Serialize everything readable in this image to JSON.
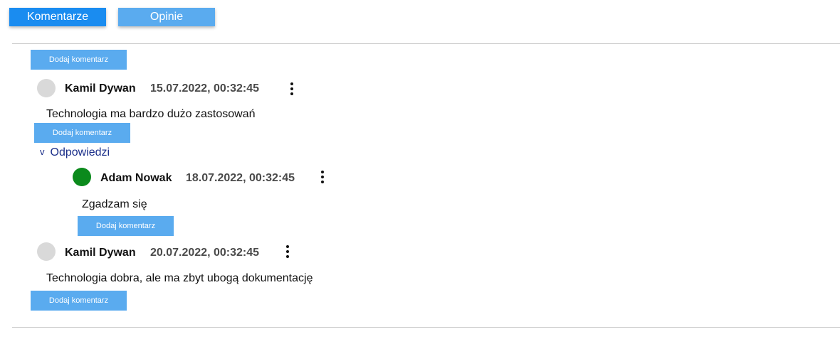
{
  "tabs": {
    "comments": "Komentarze",
    "reviews": "Opinie"
  },
  "add_comment_label": "Dodaj komentarz",
  "comments": [
    {
      "author": "Kamil Dywan",
      "timestamp": "15.07.2022, 00:32:45",
      "text": "Technologia ma bardzo dużo zastosowań",
      "replies_toggle": "Odpowiedzi",
      "replies": [
        {
          "author": "Adam Nowak",
          "timestamp": "18.07.2022, 00:32:45",
          "text": "Zgadzam się"
        }
      ]
    },
    {
      "author": "Kamil Dywan",
      "timestamp": "20.07.2022, 00:32:45",
      "text": "Technologia dobra, ale ma zbyt ubogą dokumentację"
    }
  ],
  "icons": {
    "more": "more-vertical-icon",
    "expand": "chevron-down-icon",
    "avatar": "avatar"
  },
  "colors": {
    "tab_active": "#1a8cf0",
    "button": "#5aabef",
    "avatar_default": "#d9d9d9",
    "avatar_reply": "#0b8a1c",
    "link": "#1b2f8a"
  }
}
